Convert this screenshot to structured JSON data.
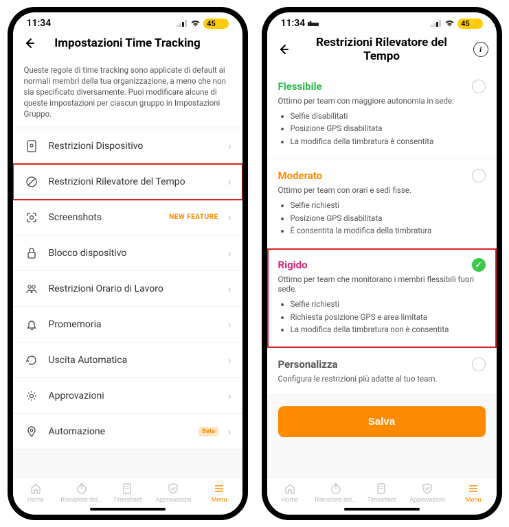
{
  "status": {
    "time": "11:34",
    "battery_text": "45"
  },
  "phone1": {
    "header_title": "Impostazioni Time Tracking",
    "description": "Queste regole di time tracking sono applicate di default ai normali membri della tua organizzazione, a meno che non sia specificato diversamente. Puoi modificare alcune di queste impostazioni per ciascun gruppo in Impostazioni Gruppo.",
    "rows": [
      {
        "label": "Restrizioni Dispositivo"
      },
      {
        "label": "Restrizioni Rilevatore del Tempo"
      },
      {
        "label": "Screenshots",
        "badge_new": "NEW FEATURE"
      },
      {
        "label": "Blocco dispositivo"
      },
      {
        "label": "Restrizioni Orario di Lavoro"
      },
      {
        "label": "Promemoria"
      },
      {
        "label": "Uscita Automatica"
      },
      {
        "label": "Approvazioni"
      },
      {
        "label": "Automazione",
        "badge_beta": "Beta"
      }
    ]
  },
  "phone2": {
    "header_title": "Restrizioni Rilevatore del Tempo",
    "options": [
      {
        "title": "Flessibile",
        "subtitle": "Ottimo per team con maggiore autonomia in sede.",
        "bullets": [
          "Selfie disabilitati",
          "Posizione GPS disabilitata",
          "La modifica della timbratura è consentita"
        ]
      },
      {
        "title": "Moderato",
        "subtitle": "Ottimo per team con orari e sedi fisse.",
        "bullets": [
          "Selfie richiesti",
          "Posizione GPS disabilitata",
          "È consentita la modifica della timbratura"
        ]
      },
      {
        "title": "Rigido",
        "subtitle": "Ottimo per team che monitorano i membri flessibili fuori sede.",
        "bullets": [
          "Selfie richiesti",
          "Richiesta posizione GPS e area limitata",
          "La modifica della timbratura non è consentita"
        ]
      },
      {
        "title": "Personalizza",
        "subtitle": "Configura le restrizioni più adatte al tuo team."
      }
    ],
    "save_label": "Salva"
  },
  "tabs": [
    {
      "label": "Home"
    },
    {
      "label": "Rilevatore del..."
    },
    {
      "label": "Timesheet"
    },
    {
      "label": "Approvazioni"
    },
    {
      "label": "Menu"
    }
  ]
}
